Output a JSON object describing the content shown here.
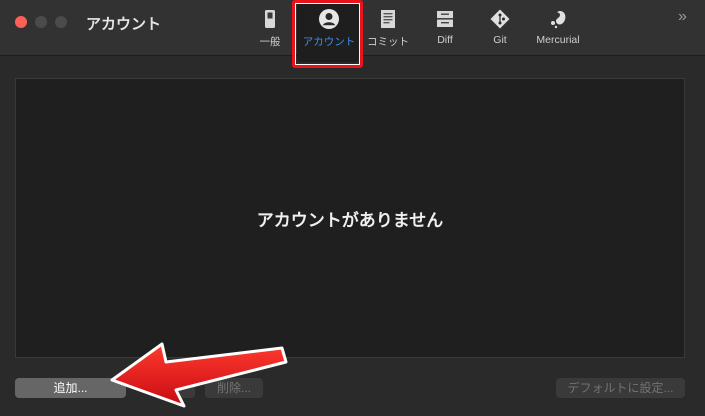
{
  "window": {
    "title": "アカウント"
  },
  "toolbar": {
    "items": [
      {
        "label": "一般",
        "icon": "switch-icon"
      },
      {
        "label": "アカウント",
        "icon": "account-icon",
        "selected": true
      },
      {
        "label": "コミット",
        "icon": "document-icon"
      },
      {
        "label": "Diff",
        "icon": "diff-icon"
      },
      {
        "label": "Git",
        "icon": "git-icon"
      },
      {
        "label": "Mercurial",
        "icon": "mercurial-icon"
      }
    ],
    "overflow": "»"
  },
  "accounts": {
    "empty_message": "アカウントがありません"
  },
  "buttons": {
    "add": "追加...",
    "delete": "削除...",
    "set_default": "デフォルトに設定..."
  },
  "colors": {
    "highlight": "#e8131b",
    "accent": "#3b8ff0",
    "arrow": "#e8131b"
  }
}
